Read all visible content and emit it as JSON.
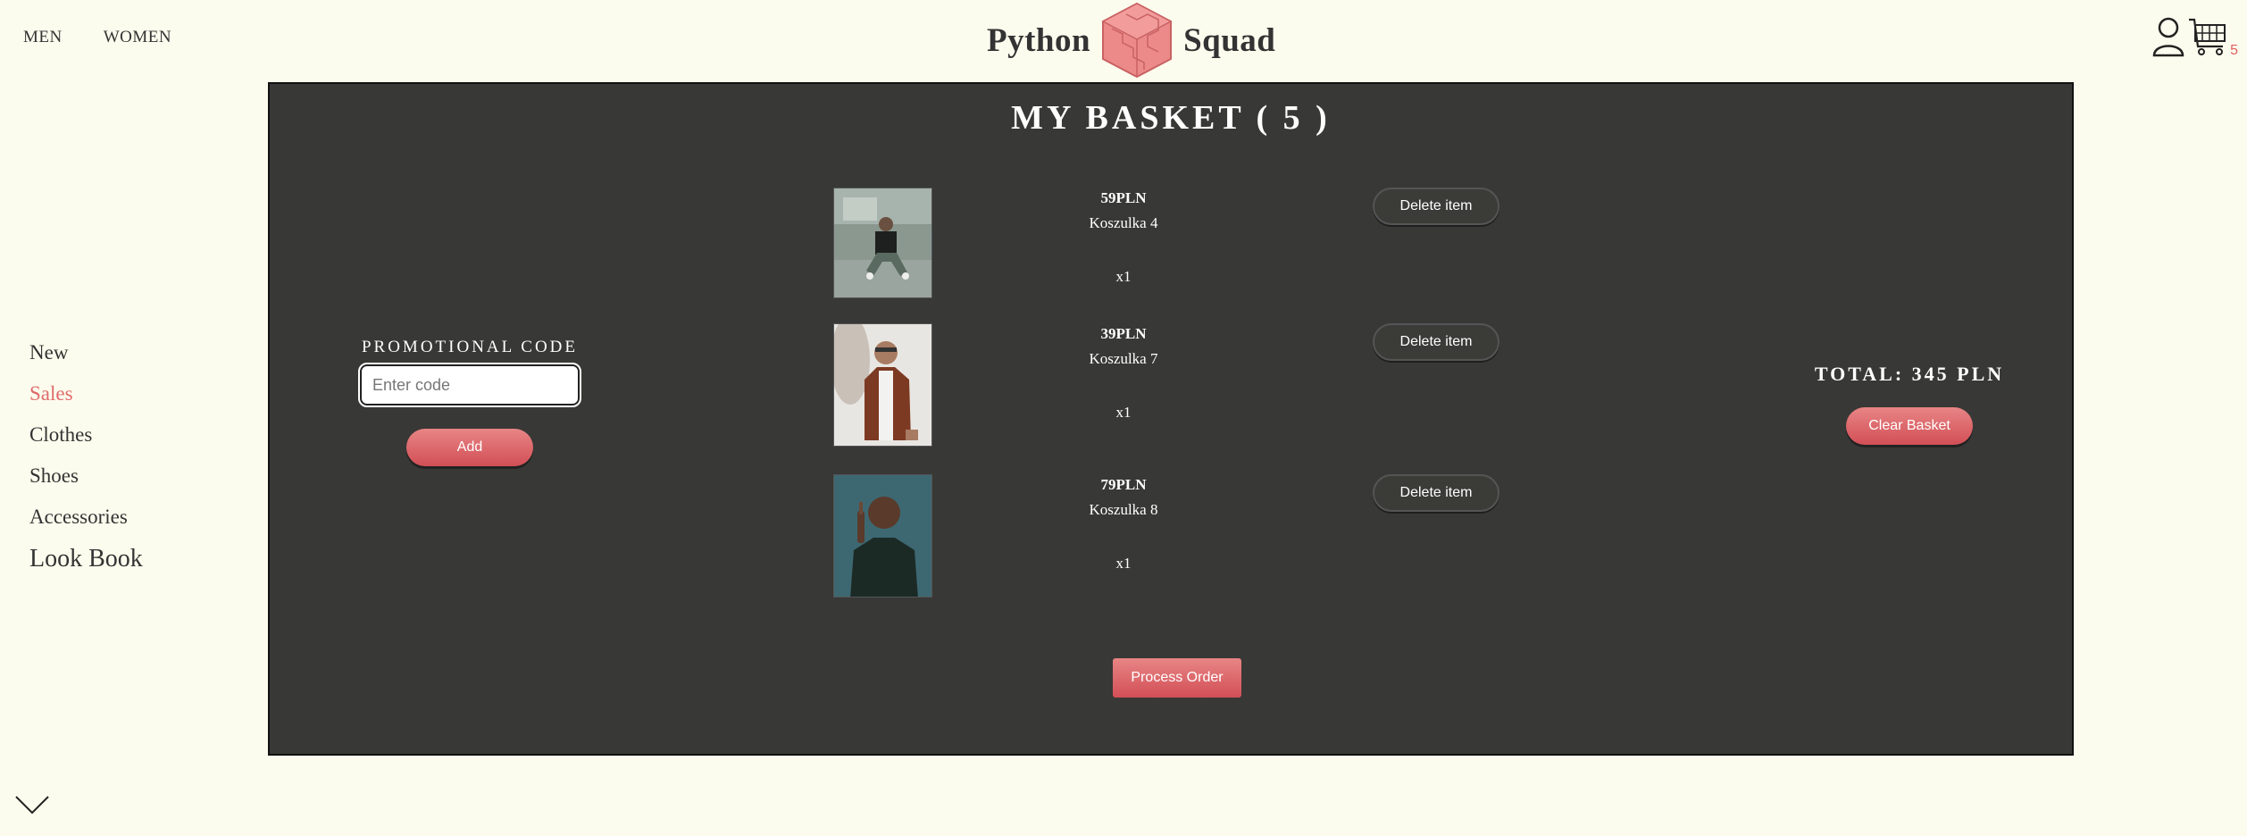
{
  "header": {
    "nav": [
      {
        "label": "MEN"
      },
      {
        "label": "WOMEN"
      }
    ],
    "brand_left": "Python",
    "brand_right": "Squad",
    "cart_count": "5"
  },
  "sidenav": {
    "items": [
      {
        "label": "New"
      },
      {
        "label": "Sales"
      },
      {
        "label": "Clothes"
      },
      {
        "label": "Shoes"
      },
      {
        "label": "Accessories"
      },
      {
        "label": "Look Book"
      }
    ]
  },
  "basket": {
    "title": "MY BASKET ( 5 )",
    "promo": {
      "label": "PROMOTIONAL CODE",
      "placeholder": "Enter code",
      "add_label": "Add"
    },
    "items": [
      {
        "price": "59PLN",
        "name": "Koszulka 4",
        "qty": "x1",
        "delete_label": "Delete item"
      },
      {
        "price": "39PLN",
        "name": "Koszulka 7",
        "qty": "x1",
        "delete_label": "Delete item"
      },
      {
        "price": "79PLN",
        "name": "Koszulka 8",
        "qty": "x1",
        "delete_label": "Delete item"
      }
    ],
    "process_label": "Process Order",
    "total_label": "TOTAL: 345 PLN",
    "clear_label": "Clear Basket"
  },
  "colors": {
    "background": "#fcfcee",
    "panel": "#383836",
    "accent": "#e06b6b"
  }
}
